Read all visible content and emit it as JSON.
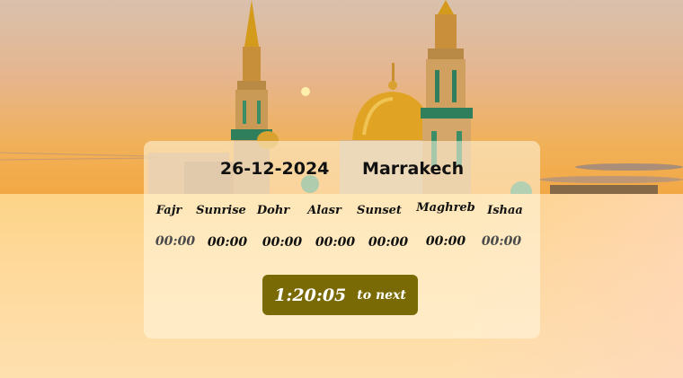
{
  "header": {
    "date": "26-12-2024",
    "city": "Marrakech"
  },
  "prayers": [
    {
      "name": "Fajr",
      "time": "00:00"
    },
    {
      "name": "Sunrise",
      "time": "00:00"
    },
    {
      "name": "Dohr",
      "time": "00:00"
    },
    {
      "name": "Alasr",
      "time": "00:00"
    },
    {
      "name": "Sunset",
      "time": "00:00"
    },
    {
      "name": "Maghreb",
      "time": "00:00"
    },
    {
      "name": "Ishaa",
      "time": "00:00"
    }
  ],
  "countdown": {
    "time": "1:20:05",
    "label": "to next"
  },
  "colors": {
    "countdown_bg": "#7a6a05",
    "card_bg": "rgba(255,248,225,0.55)"
  }
}
